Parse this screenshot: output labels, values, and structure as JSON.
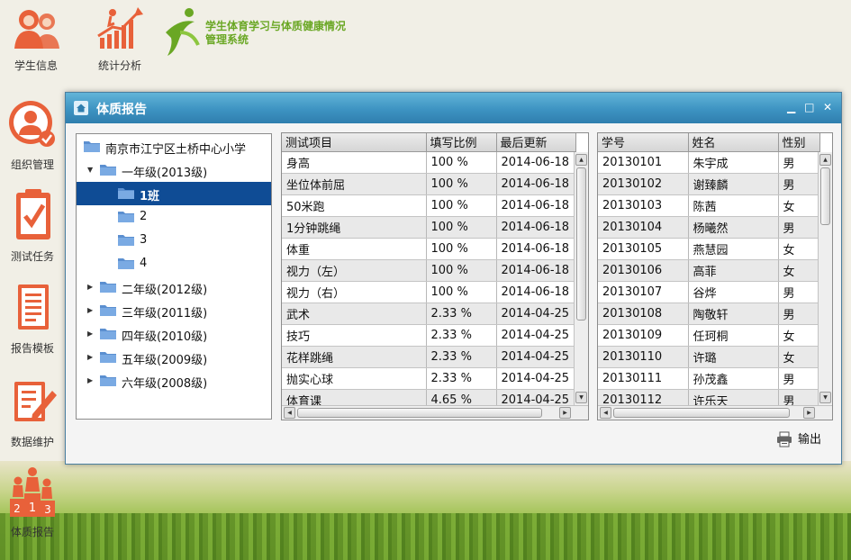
{
  "top_nav": {
    "items": [
      {
        "label": "学生信息",
        "icon": "students-icon"
      },
      {
        "label": "统计分析",
        "icon": "chart-growth-icon"
      }
    ],
    "app_title_line1": "学生体育学习与体质健康情况",
    "app_title_line2": "管理系统"
  },
  "side_nav": {
    "items": [
      {
        "label": "组织管理",
        "icon": "organization-icon"
      },
      {
        "label": "测试任务",
        "icon": "clipboard-check-icon"
      },
      {
        "label": "报告模板",
        "icon": "document-icon"
      },
      {
        "label": "数据维护",
        "icon": "pencil-edit-icon"
      },
      {
        "label": "体质报告",
        "icon": "podium-icon"
      }
    ]
  },
  "dialog": {
    "title": "体质报告",
    "window_buttons": {
      "minimize": "▁",
      "maximize": "□",
      "close": "✕"
    },
    "export_label": "输出"
  },
  "tree": {
    "root": "南京市江宁区土桥中心小学",
    "grade1": "一年级(2013级)",
    "classes": [
      "1班",
      "2",
      "3",
      "4"
    ],
    "grades": [
      "二年级(2012级)",
      "三年级(2011级)",
      "四年级(2010级)",
      "五年级(2009级)",
      "六年级(2008级)"
    ]
  },
  "tests_table": {
    "columns": [
      "测试项目",
      "填写比例",
      "最后更新"
    ],
    "rows": [
      [
        "身高",
        "100 %",
        "2014-06-18"
      ],
      [
        "坐位体前屈",
        "100 %",
        "2014-06-18"
      ],
      [
        "50米跑",
        "100 %",
        "2014-06-18"
      ],
      [
        "1分钟跳绳",
        "100 %",
        "2014-06-18"
      ],
      [
        "体重",
        "100 %",
        "2014-06-18"
      ],
      [
        "视力（左）",
        "100 %",
        "2014-06-18"
      ],
      [
        "视力（右）",
        "100 %",
        "2014-06-18"
      ],
      [
        "武术",
        "2.33 %",
        "2014-04-25"
      ],
      [
        "技巧",
        "2.33 %",
        "2014-04-25"
      ],
      [
        "花样跳绳",
        "2.33 %",
        "2014-04-25"
      ],
      [
        "抛实心球",
        "2.33 %",
        "2014-04-25"
      ],
      [
        "体育课",
        "4.65 %",
        "2014-04-25"
      ]
    ]
  },
  "students_table": {
    "columns": [
      "学号",
      "姓名",
      "性别"
    ],
    "rows": [
      [
        "20130101",
        "朱宇成",
        "男"
      ],
      [
        "20130102",
        "谢臻麟",
        "男"
      ],
      [
        "20130103",
        "陈茜",
        "女"
      ],
      [
        "20130104",
        "杨曦然",
        "男"
      ],
      [
        "20130105",
        "燕慧园",
        "女"
      ],
      [
        "20130106",
        "高菲",
        "女"
      ],
      [
        "20130107",
        "谷烨",
        "男"
      ],
      [
        "20130108",
        "陶敬轩",
        "男"
      ],
      [
        "20130109",
        "任珂桐",
        "女"
      ],
      [
        "20130110",
        "许璐",
        "女"
      ],
      [
        "20130111",
        "孙茂鑫",
        "男"
      ],
      [
        "20130112",
        "许乐天",
        "男"
      ]
    ]
  },
  "colors": {
    "title_bar": "#3d93c2",
    "selected_row": "#0f4c95",
    "icon_orange": "#e8613a",
    "logo_green": "#6aa724"
  }
}
